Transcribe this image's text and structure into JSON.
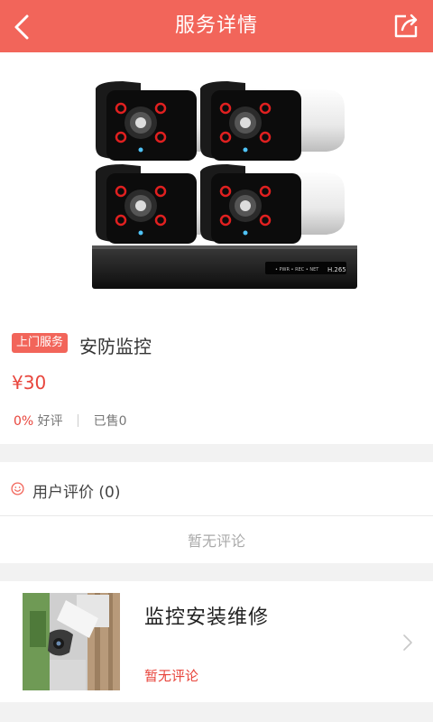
{
  "header": {
    "title": "服务详情",
    "back_icon": "chevron-left-icon",
    "share_icon": "share-icon"
  },
  "hero": {
    "image": "security-cameras-and-nvr-photo",
    "nvr_label": "H.265",
    "carousel_active_index": 0,
    "carousel_count": 1
  },
  "product": {
    "tag": "上门服务",
    "name": "安防监控",
    "price": "¥30",
    "rating_percent": "0%",
    "rating_label": "好评",
    "sold_label": "已售0"
  },
  "reviews": {
    "label": "用户评价 (0)",
    "empty_text": "暂无评论",
    "icon": "smile-icon"
  },
  "related": {
    "title": "监控安装维修",
    "subtitle": "暂无评论",
    "thumb": "camera-on-wall-photo",
    "chevron": "chevron-right-icon"
  },
  "colors": {
    "accent": "#f2655a",
    "price": "#e8453c",
    "background": "#f2f2f2"
  }
}
